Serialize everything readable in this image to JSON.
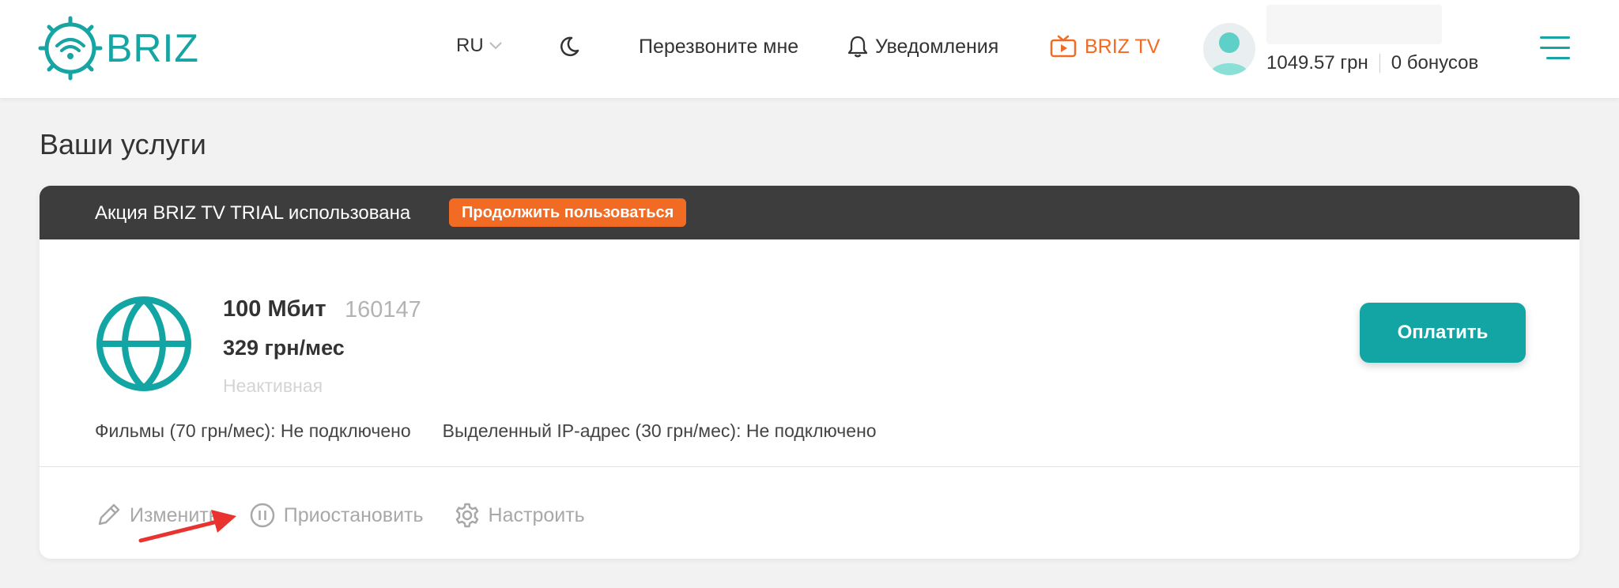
{
  "header": {
    "brand": "BRIZ",
    "language": "RU",
    "callback_label": "Перезвоните мне",
    "notifications_label": "Уведомления",
    "tv_label": "BRIZ TV",
    "balance": "1049.57 грн",
    "bonuses": "0 бонусов"
  },
  "page": {
    "title": "Ваши услуги"
  },
  "promo": {
    "text": "Акция BRIZ TV TRIAL использована",
    "button_label": "Продолжить пользоваться"
  },
  "service": {
    "name": "100 Мбит",
    "id": "160147",
    "price": "329 грн/мес",
    "status": "Неактивная",
    "pay_label": "Оплатить",
    "addons": [
      "Фильмы (70 грн/мес): Не подключено",
      "Выделенный IP-адрес (30 грн/мес): Не подключено"
    ],
    "actions": {
      "edit": "Изменить",
      "pause": "Приостановить",
      "configure": "Настроить"
    }
  },
  "colors": {
    "brand_teal": "#17a5a3",
    "accent_orange": "#f26b24",
    "promo_bar": "#3d3d3d",
    "annotation_arrow": "#e8332f"
  }
}
